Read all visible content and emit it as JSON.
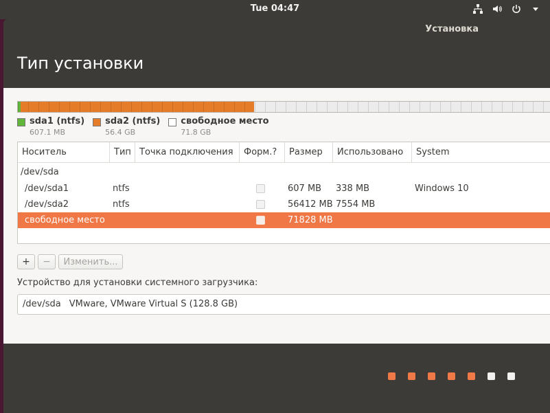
{
  "topbar": {
    "clock": "Tue 04:47",
    "icons": [
      "network-icon",
      "volume-icon",
      "power-icon",
      "menu-arrow-icon"
    ]
  },
  "window": {
    "title": "Установка",
    "page_title": "Тип установки"
  },
  "partition_bar": {
    "segments": [
      {
        "name": "sda1 (ntfs)",
        "fraction": 0.0047,
        "color": "#62b53b"
      },
      {
        "name": "sda2 (ntfs)",
        "fraction": 0.438,
        "color": "#e57c2a"
      },
      {
        "name": "свободное место",
        "fraction": 0.5573,
        "color": "#ececec"
      }
    ]
  },
  "legend": [
    {
      "name": "sda1 (ntfs)",
      "size": "607.1 MB",
      "color": "#62b53b"
    },
    {
      "name": "sda2 (ntfs)",
      "size": "56.4 GB",
      "color": "#e57c2a"
    },
    {
      "name": "свободное место",
      "size": "71.8 GB",
      "color": "#ffffff"
    }
  ],
  "table": {
    "columns": [
      "Носитель",
      "Тип",
      "Точка подключения",
      "Форм.?",
      "Размер",
      "Использовано",
      "System"
    ],
    "group": "/dev/sda",
    "rows": [
      {
        "device": "/dev/sda1",
        "type": "ntfs",
        "mount": "",
        "size": "607 MB",
        "used": "338 MB",
        "system": "Windows 10",
        "selected": false
      },
      {
        "device": "/dev/sda2",
        "type": "ntfs",
        "mount": "",
        "size": "56412 MB",
        "used": "7554 MB",
        "system": "",
        "selected": false
      },
      {
        "device": "свободное место",
        "type": "",
        "mount": "",
        "size": "71828 MB",
        "used": "",
        "system": "",
        "selected": true
      }
    ]
  },
  "buttons": {
    "add": "+",
    "remove": "−",
    "edit": "Изменить..."
  },
  "bootloader": {
    "label": "Устройство для установки системного загрузчика:",
    "device": "/dev/sda",
    "description": "VMware, VMware Virtual S (128.8 GB)"
  },
  "progress_dots": {
    "completed": 5,
    "total": 7,
    "active_color": "#ef7a48",
    "inactive_color": "#f2f1f0"
  }
}
